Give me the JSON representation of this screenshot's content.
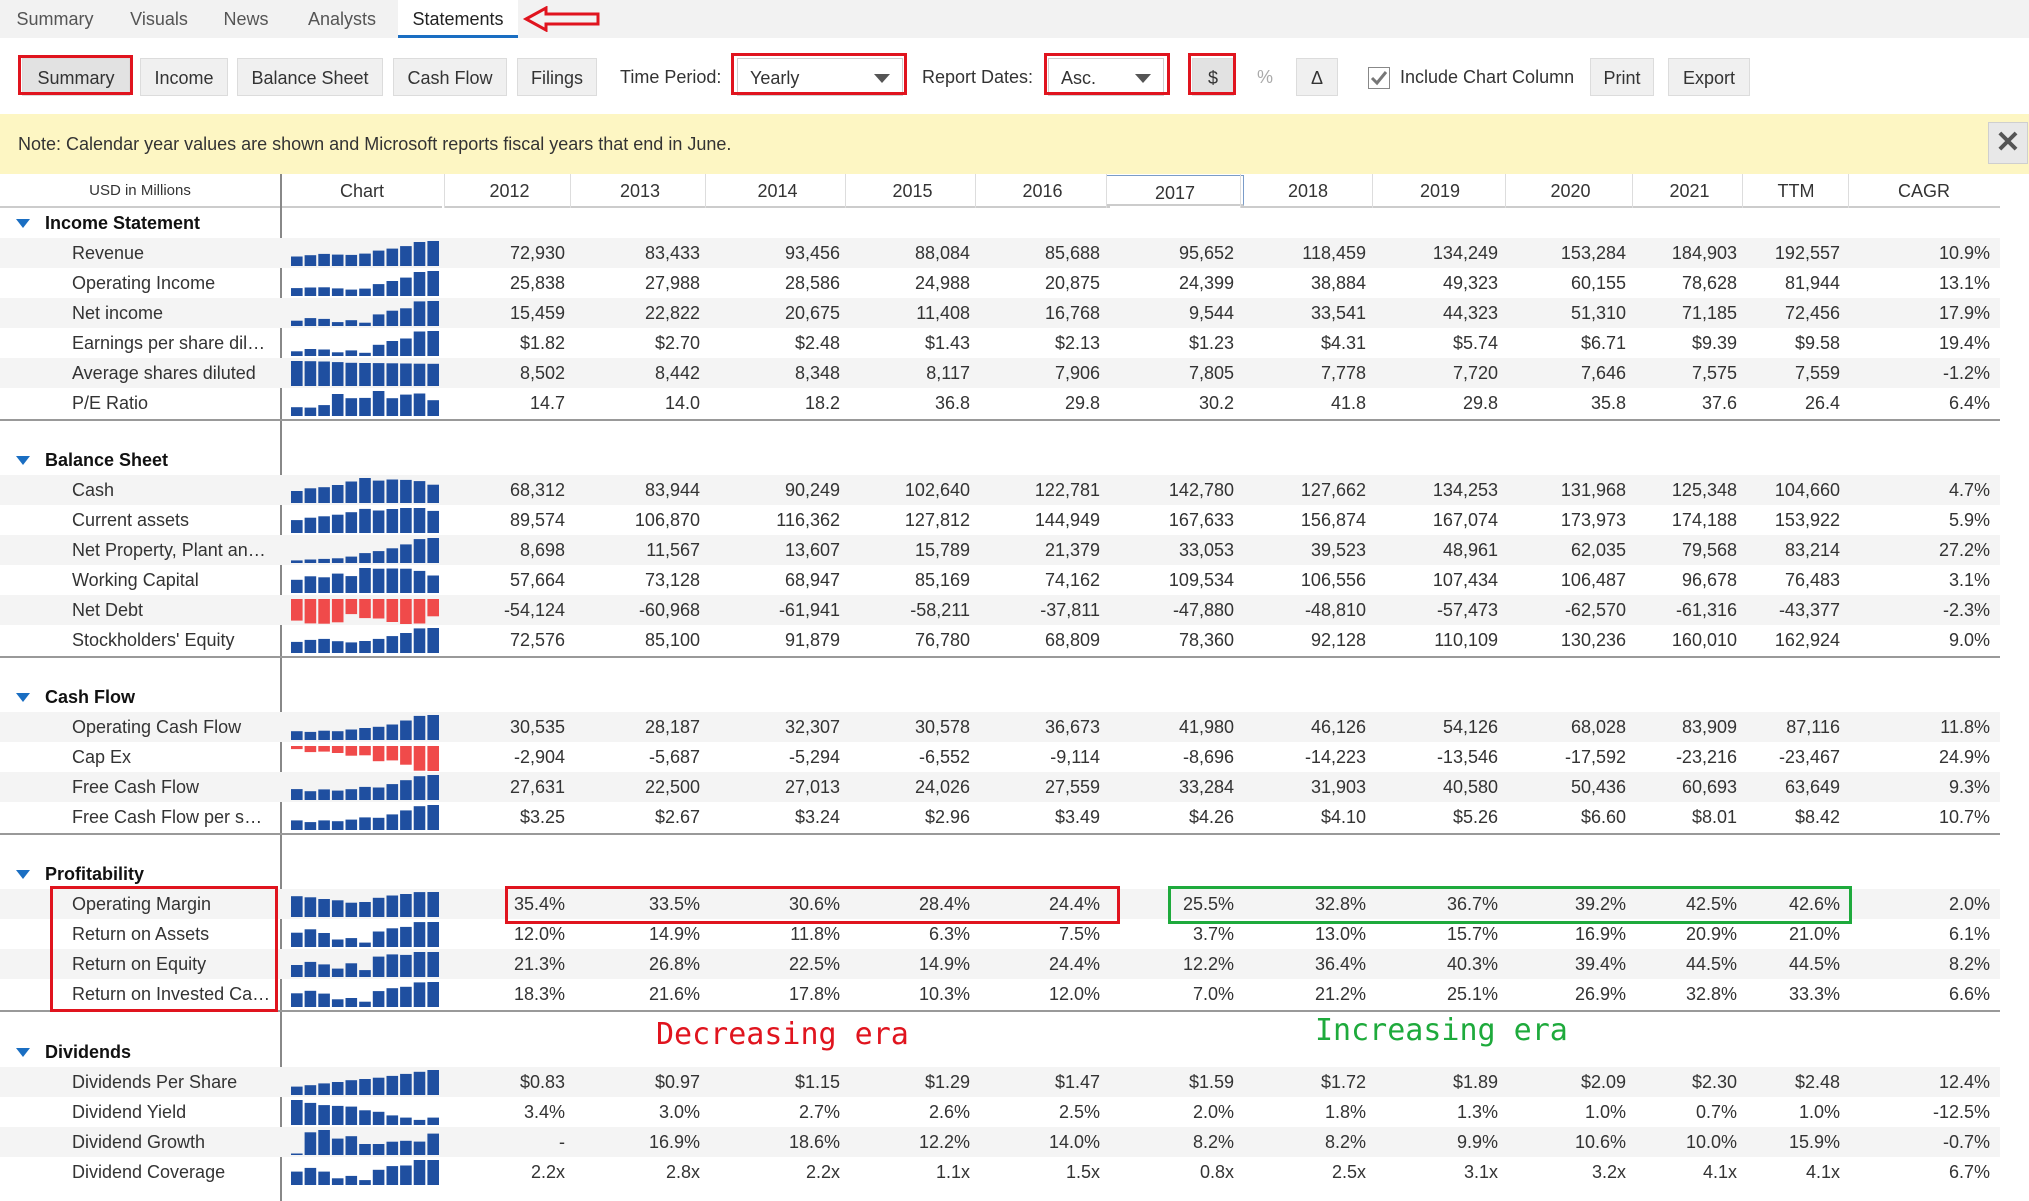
{
  "top_tabs": [
    "Summary",
    "Visuals",
    "News",
    "Analysts",
    "Statements"
  ],
  "toolbar": {
    "buttons": [
      "Summary",
      "Income",
      "Balance Sheet",
      "Cash Flow",
      "Filings"
    ],
    "time_period_label": "Time Period:",
    "time_period_value": "Yearly",
    "report_dates_label": "Report Dates:",
    "report_dates_value": "Asc.",
    "dollar": "$",
    "percent": "%",
    "delta": "Δ",
    "include_chart": "Include Chart Column",
    "print": "Print",
    "export": "Export"
  },
  "note": "Note: Calendar year values are shown and Microsoft reports fiscal years that end in June.",
  "close_glyph": "✕",
  "header": {
    "units": "USD in Millions",
    "chart": "Chart",
    "years": [
      "2012",
      "2013",
      "2014",
      "2015",
      "2016",
      "2017",
      "2018",
      "2019",
      "2020",
      "2021",
      "TTM",
      "CAGR"
    ]
  },
  "annotations": {
    "decreasing": "Decreasing era",
    "increasing": "Increasing era"
  },
  "colors": {
    "accent": "#1a6ec2",
    "bar_pos": "#1f4fa0",
    "bar_neg": "#f04a4a",
    "annot_red": "#e0141e",
    "annot_green": "#1eaa3c"
  },
  "sections": [
    {
      "title": "Income Statement",
      "rows": [
        {
          "label": "Revenue",
          "values": [
            "72,930",
            "83,433",
            "93,456",
            "88,084",
            "85,688",
            "95,652",
            "118,459",
            "134,249",
            "153,284",
            "184,903",
            "192,557",
            "10.9%"
          ],
          "bars": [
            72930,
            83433,
            93456,
            88084,
            85688,
            95652,
            118459,
            134249,
            153284,
            184903,
            192557
          ]
        },
        {
          "label": "Operating Income",
          "values": [
            "25,838",
            "27,988",
            "28,586",
            "24,988",
            "20,875",
            "24,399",
            "38,884",
            "49,323",
            "60,155",
            "78,628",
            "81,944",
            "13.1%"
          ],
          "bars": [
            25838,
            27988,
            28586,
            24988,
            20875,
            24399,
            38884,
            49323,
            60155,
            78628,
            81944
          ]
        },
        {
          "label": "Net income",
          "values": [
            "15,459",
            "22,822",
            "20,675",
            "11,408",
            "16,768",
            "9,544",
            "33,541",
            "44,323",
            "51,310",
            "71,185",
            "72,456",
            "17.9%"
          ],
          "bars": [
            15459,
            22822,
            20675,
            11408,
            16768,
            9544,
            33541,
            44323,
            51310,
            71185,
            72456
          ]
        },
        {
          "label": "Earnings per share diluted",
          "values": [
            "$1.82",
            "$2.70",
            "$2.48",
            "$1.43",
            "$2.13",
            "$1.23",
            "$4.31",
            "$5.74",
            "$6.71",
            "$9.39",
            "$9.58",
            "19.4%"
          ],
          "bars": [
            1.82,
            2.7,
            2.48,
            1.43,
            2.13,
            1.23,
            4.31,
            5.74,
            6.71,
            9.39,
            9.58
          ]
        },
        {
          "label": "Average shares diluted",
          "values": [
            "8,502",
            "8,442",
            "8,348",
            "8,117",
            "7,906",
            "7,805",
            "7,778",
            "7,720",
            "7,646",
            "7,575",
            "7,559",
            "-1.2%"
          ],
          "bars": [
            8502,
            8442,
            8348,
            8117,
            7906,
            7805,
            7778,
            7720,
            7646,
            7575,
            7559
          ]
        },
        {
          "label": "P/E Ratio",
          "values": [
            "14.7",
            "14.0",
            "18.2",
            "36.8",
            "29.8",
            "30.2",
            "41.8",
            "29.8",
            "35.8",
            "37.6",
            "26.4",
            "6.4%"
          ],
          "bars": [
            14.7,
            14.0,
            18.2,
            36.8,
            29.8,
            30.2,
            41.8,
            29.8,
            35.8,
            37.6,
            26.4
          ]
        }
      ]
    },
    {
      "title": "Balance Sheet",
      "rows": [
        {
          "label": "Cash",
          "values": [
            "68,312",
            "83,944",
            "90,249",
            "102,640",
            "122,781",
            "142,780",
            "127,662",
            "134,253",
            "131,968",
            "125,348",
            "104,660",
            "4.7%"
          ],
          "bars": [
            68312,
            83944,
            90249,
            102640,
            122781,
            142780,
            127662,
            134253,
            131968,
            125348,
            104660
          ]
        },
        {
          "label": "Current assets",
          "values": [
            "89,574",
            "106,870",
            "116,362",
            "127,812",
            "144,949",
            "167,633",
            "156,874",
            "167,074",
            "173,973",
            "174,188",
            "153,922",
            "5.9%"
          ],
          "bars": [
            89574,
            106870,
            116362,
            127812,
            144949,
            167633,
            156874,
            167074,
            173973,
            174188,
            153922
          ]
        },
        {
          "label": "Net Property, Plant and Equipment",
          "values": [
            "8,698",
            "11,567",
            "13,607",
            "15,789",
            "21,379",
            "33,053",
            "39,523",
            "48,961",
            "62,035",
            "79,568",
            "83,214",
            "27.2%"
          ],
          "bars": [
            8698,
            11567,
            13607,
            15789,
            21379,
            33053,
            39523,
            48961,
            62035,
            79568,
            83214
          ]
        },
        {
          "label": "Working Capital",
          "values": [
            "57,664",
            "73,128",
            "68,947",
            "85,169",
            "74,162",
            "109,534",
            "106,556",
            "107,434",
            "106,487",
            "96,678",
            "76,483",
            "3.1%"
          ],
          "bars": [
            57664,
            73128,
            68947,
            85169,
            74162,
            109534,
            106556,
            107434,
            106487,
            96678,
            76483
          ]
        },
        {
          "label": "Net Debt",
          "values": [
            "-54,124",
            "-60,968",
            "-61,941",
            "-58,211",
            "-37,811",
            "-47,880",
            "-48,810",
            "-57,473",
            "-62,570",
            "-61,316",
            "-43,377",
            "-2.3%"
          ],
          "bars": [
            -54124,
            -60968,
            -61941,
            -58211,
            -37811,
            -47880,
            -48810,
            -57473,
            -62570,
            -61316,
            -43377
          ]
        },
        {
          "label": "Stockholders' Equity",
          "values": [
            "72,576",
            "85,100",
            "91,879",
            "76,780",
            "68,809",
            "78,360",
            "92,128",
            "110,109",
            "130,236",
            "160,010",
            "162,924",
            "9.0%"
          ],
          "bars": [
            72576,
            85100,
            91879,
            76780,
            68809,
            78360,
            92128,
            110109,
            130236,
            160010,
            162924
          ]
        }
      ]
    },
    {
      "title": "Cash Flow",
      "rows": [
        {
          "label": "Operating Cash Flow",
          "values": [
            "30,535",
            "28,187",
            "32,307",
            "30,578",
            "36,673",
            "41,980",
            "46,126",
            "54,126",
            "68,028",
            "83,909",
            "87,116",
            "11.8%"
          ],
          "bars": [
            30535,
            28187,
            32307,
            30578,
            36673,
            41980,
            46126,
            54126,
            68028,
            83909,
            87116
          ]
        },
        {
          "label": "Cap Ex",
          "values": [
            "-2,904",
            "-5,687",
            "-5,294",
            "-6,552",
            "-9,114",
            "-8,696",
            "-14,223",
            "-13,546",
            "-17,592",
            "-23,216",
            "-23,467",
            "24.9%"
          ],
          "bars": [
            -2904,
            -5687,
            -5294,
            -6552,
            -9114,
            -8696,
            -14223,
            -13546,
            -17592,
            -23216,
            -23467
          ]
        },
        {
          "label": "Free Cash Flow",
          "values": [
            "27,631",
            "22,500",
            "27,013",
            "24,026",
            "27,559",
            "33,284",
            "31,903",
            "40,580",
            "50,436",
            "60,693",
            "63,649",
            "9.3%"
          ],
          "bars": [
            27631,
            22500,
            27013,
            24026,
            27559,
            33284,
            31903,
            40580,
            50436,
            60693,
            63649
          ]
        },
        {
          "label": "Free Cash Flow per share",
          "values": [
            "$3.25",
            "$2.67",
            "$3.24",
            "$2.96",
            "$3.49",
            "$4.26",
            "$4.10",
            "$5.26",
            "$6.60",
            "$8.01",
            "$8.42",
            "10.7%"
          ],
          "bars": [
            3.25,
            2.67,
            3.24,
            2.96,
            3.49,
            4.26,
            4.1,
            5.26,
            6.6,
            8.01,
            8.42
          ]
        }
      ]
    },
    {
      "title": "Profitability",
      "rows": [
        {
          "label": "Operating Margin",
          "values": [
            "35.4%",
            "33.5%",
            "30.6%",
            "28.4%",
            "24.4%",
            "25.5%",
            "32.8%",
            "36.7%",
            "39.2%",
            "42.5%",
            "42.6%",
            "2.0%"
          ],
          "bars": [
            35.4,
            33.5,
            30.6,
            28.4,
            24.4,
            25.5,
            32.8,
            36.7,
            39.2,
            42.5,
            42.6
          ]
        },
        {
          "label": "Return on Assets",
          "values": [
            "12.0%",
            "14.9%",
            "11.8%",
            "6.3%",
            "7.5%",
            "3.7%",
            "13.0%",
            "15.7%",
            "16.9%",
            "20.9%",
            "21.0%",
            "6.1%"
          ],
          "bars": [
            12.0,
            14.9,
            11.8,
            6.3,
            7.5,
            3.7,
            13.0,
            15.7,
            16.9,
            20.9,
            21.0
          ]
        },
        {
          "label": "Return on Equity",
          "values": [
            "21.3%",
            "26.8%",
            "22.5%",
            "14.9%",
            "24.4%",
            "12.2%",
            "36.4%",
            "40.3%",
            "39.4%",
            "44.5%",
            "44.5%",
            "8.2%"
          ],
          "bars": [
            21.3,
            26.8,
            22.5,
            14.9,
            24.4,
            12.2,
            36.4,
            40.3,
            39.4,
            44.5,
            44.5
          ]
        },
        {
          "label": "Return on Invested Capital",
          "values": [
            "18.3%",
            "21.6%",
            "17.8%",
            "10.3%",
            "12.0%",
            "7.0%",
            "21.2%",
            "25.1%",
            "26.9%",
            "32.8%",
            "33.3%",
            "6.6%"
          ],
          "bars": [
            18.3,
            21.6,
            17.8,
            10.3,
            12.0,
            7.0,
            21.2,
            25.1,
            26.9,
            32.8,
            33.3
          ]
        }
      ]
    },
    {
      "title": "Dividends",
      "rows": [
        {
          "label": "Dividends Per Share",
          "values": [
            "$0.83",
            "$0.97",
            "$1.15",
            "$1.29",
            "$1.47",
            "$1.59",
            "$1.72",
            "$1.89",
            "$2.09",
            "$2.30",
            "$2.48",
            "12.4%"
          ],
          "bars": [
            0.83,
            0.97,
            1.15,
            1.29,
            1.47,
            1.59,
            1.72,
            1.89,
            2.09,
            2.3,
            2.48
          ]
        },
        {
          "label": "Dividend Yield",
          "values": [
            "3.4%",
            "3.0%",
            "2.7%",
            "2.6%",
            "2.5%",
            "2.0%",
            "1.8%",
            "1.3%",
            "1.0%",
            "0.7%",
            "1.0%",
            "-12.5%"
          ],
          "bars": [
            3.4,
            3.0,
            2.7,
            2.6,
            2.5,
            2.0,
            1.8,
            1.3,
            1.0,
            0.7,
            1.0
          ]
        },
        {
          "label": "Dividend Growth",
          "values": [
            "-",
            "16.9%",
            "18.6%",
            "12.2%",
            "14.0%",
            "8.2%",
            "8.2%",
            "9.9%",
            "10.6%",
            "10.0%",
            "15.9%",
            "-0.7%"
          ],
          "bars": [
            0,
            16.9,
            18.6,
            12.2,
            14.0,
            8.2,
            8.2,
            9.9,
            10.6,
            10.0,
            15.9
          ]
        },
        {
          "label": "Dividend Coverage",
          "values": [
            "2.2x",
            "2.8x",
            "2.2x",
            "1.1x",
            "1.5x",
            "0.8x",
            "2.5x",
            "3.1x",
            "3.2x",
            "4.1x",
            "4.1x",
            "6.7%"
          ],
          "bars": [
            2.2,
            2.8,
            2.2,
            1.1,
            1.5,
            0.8,
            2.5,
            3.1,
            3.2,
            4.1,
            4.1
          ]
        }
      ]
    }
  ]
}
